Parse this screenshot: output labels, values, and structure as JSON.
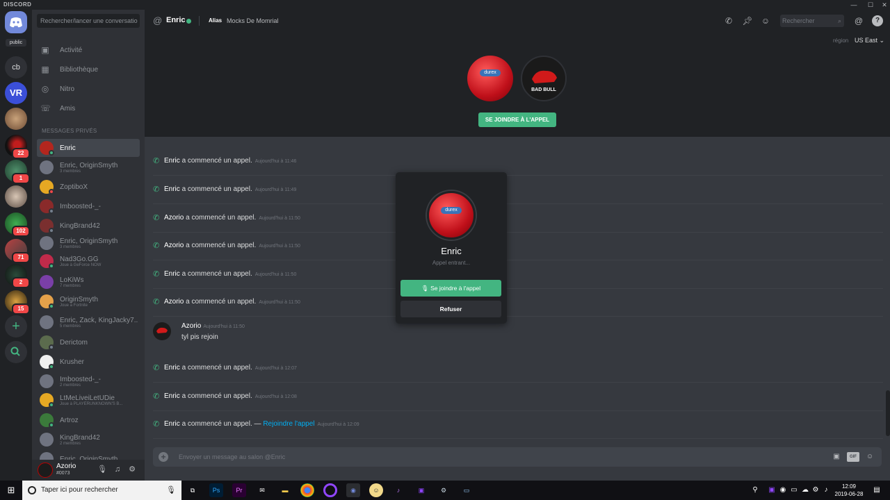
{
  "window": {
    "brand": "DISCORD",
    "controls": [
      "—",
      "☐",
      "✕"
    ]
  },
  "servers": {
    "home_label": "public",
    "items": [
      {
        "name": "cb",
        "badge": null
      },
      {
        "name": "VR",
        "badge": null
      },
      {
        "name": "server-3",
        "badge": null
      },
      {
        "name": "server-4",
        "badge": "22"
      },
      {
        "name": "server-5",
        "badge": "1"
      },
      {
        "name": "server-6",
        "badge": null
      },
      {
        "name": "server-7",
        "badge": "102"
      },
      {
        "name": "server-8",
        "badge": "71"
      },
      {
        "name": "server-9",
        "badge": "2"
      },
      {
        "name": "server-10",
        "badge": "15"
      }
    ]
  },
  "sidebar": {
    "search_placeholder": "Rechercher/lancer une conversatio",
    "nav": [
      {
        "label": "Activité",
        "icon": "gamepad-icon"
      },
      {
        "label": "Bibliothèque",
        "icon": "library-icon"
      },
      {
        "label": "Nitro",
        "icon": "nitro-icon"
      },
      {
        "label": "Amis",
        "icon": "friends-icon"
      }
    ],
    "dm_header": "MESSAGES PRIVÉS",
    "dms": [
      {
        "name": "Enric",
        "sub": "",
        "status": "online",
        "active": true
      },
      {
        "name": "Enric, OriginSmyth",
        "sub": "3 membres",
        "status": "",
        "active": false
      },
      {
        "name": "ZoptiboX",
        "sub": "",
        "status": "dnd",
        "active": false
      },
      {
        "name": "Imboosted-_-",
        "sub": "",
        "status": "offline",
        "active": false
      },
      {
        "name": "KingBrand42",
        "sub": "",
        "status": "offline",
        "active": false
      },
      {
        "name": "Enric, OriginSmyth",
        "sub": "3 membres",
        "status": "",
        "active": false
      },
      {
        "name": "Nad3Go.GG",
        "sub": "Joue à GeForce NOW",
        "status": "online",
        "active": false
      },
      {
        "name": "LoKiWs",
        "sub": "7 membres",
        "status": "",
        "active": false
      },
      {
        "name": "OriginSmyth",
        "sub": "Joue à Fortnite",
        "status": "online",
        "active": false
      },
      {
        "name": "Enric, Zack, KingJacky7...",
        "sub": "5 membres",
        "status": "",
        "active": false
      },
      {
        "name": "Derictom",
        "sub": "",
        "status": "offline",
        "active": false
      },
      {
        "name": "Krusher",
        "sub": "",
        "status": "online",
        "active": false
      },
      {
        "name": "Imboosted-_-",
        "sub": "2 membres",
        "status": "",
        "active": false
      },
      {
        "name": "LtMeLiveiLetUDie",
        "sub": "Joue à PLAYERUNKNOWN'S B...",
        "status": "online",
        "active": false
      },
      {
        "name": "Artroz",
        "sub": "",
        "status": "online",
        "active": false
      },
      {
        "name": "KingBrand42",
        "sub": "2 membres",
        "status": "",
        "active": false
      },
      {
        "name": "Enric, OriginSmyth",
        "sub": "",
        "status": "",
        "active": false
      }
    ]
  },
  "user": {
    "name": "Azorio",
    "tag": "#0073"
  },
  "header": {
    "title": "Enric",
    "alias_label": "Alias",
    "alias_value": "Mocks De Momrial",
    "search_placeholder": "Rechercher"
  },
  "call": {
    "region_label": "région",
    "region_value": "US East",
    "join_label": "SE JOINDRE À L'APPEL",
    "avatar_left_text": "durex",
    "avatar_right_text": "BAD BULL"
  },
  "messages": [
    {
      "author": "Enric",
      "text": " a commencé un appel.",
      "link": "",
      "time": "Aujourd'hui à 11:46"
    },
    {
      "author": "Enric",
      "text": " a commencé un appel.",
      "link": "",
      "time": "Aujourd'hui à 11:49"
    },
    {
      "author": "Azorio",
      "text": " a commencé un appel.",
      "link": "",
      "time": "Aujourd'hui à 11:50"
    },
    {
      "author": "Azorio",
      "text": " a commencé un appel.",
      "link": "",
      "time": "Aujourd'hui à 11:50"
    },
    {
      "author": "Enric",
      "text": " a commencé un appel.",
      "link": "",
      "time": "Aujourd'hui à 11:50"
    },
    {
      "author": "Azorio",
      "text": " a commencé un appel.",
      "link": "",
      "time": "Aujourd'hui à 11:50"
    },
    {
      "author": "Enric",
      "text": " a commencé un appel.",
      "link": "",
      "time": "Aujourd'hui à 12:07"
    },
    {
      "author": "Enric",
      "text": " a commencé un appel.",
      "link": "",
      "time": "Aujourd'hui à 12:08"
    },
    {
      "author": "Enric",
      "text": " a commencé un appel. — ",
      "link": "Rejoindre l'appel",
      "time": "Aujourd'hui à 12:09"
    }
  ],
  "chat_message": {
    "author": "Azorio",
    "time": "Aujourd'hui à 11:50",
    "body": "tyl pis rejoin",
    "avatar_text": "BAD BULL"
  },
  "composer": {
    "placeholder": "Envoyer un message au salon @Enric"
  },
  "popup": {
    "name": "Enric",
    "status": "Appel entrant...",
    "join_label": "Se joindre à l'appel",
    "decline_label": "Refuser"
  },
  "taskbar": {
    "search_placeholder": "Taper ici pour rechercher",
    "time": "12:09",
    "date": "2019-06-28"
  },
  "colors": {
    "accent_green": "#43b581",
    "link_blue": "#00b0f4",
    "badge_red": "#f04747",
    "bg_dark": "#202225",
    "bg_channels": "#2f3136",
    "bg_chat": "#36393f"
  }
}
